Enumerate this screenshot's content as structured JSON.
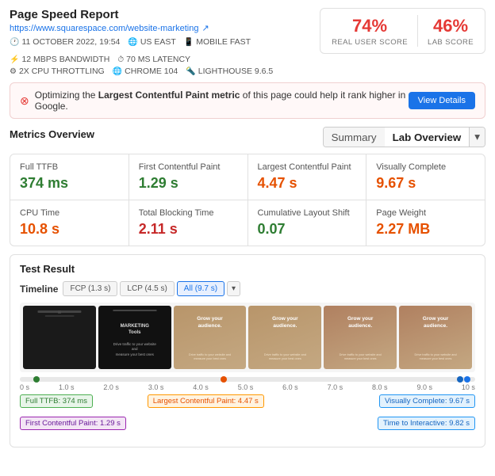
{
  "header": {
    "title": "Page Speed Report",
    "url": "https://www.squarespace.com/website-marketing",
    "meta": [
      {
        "icon": "🕐",
        "text": "11 OCTOBER 2022, 19:54"
      },
      {
        "icon": "🌐",
        "text": "US EAST"
      },
      {
        "icon": "📱",
        "text": "MOBILE FAST"
      },
      {
        "icon": "⚡",
        "text": "12 MBPS BANDWIDTH"
      },
      {
        "icon": "⏱",
        "text": "70 MS LATENCY"
      },
      {
        "icon": "⚙",
        "text": "2X CPU THROTTLING"
      },
      {
        "icon": "🌐",
        "text": "CHROME 104"
      },
      {
        "icon": "🔦",
        "text": "LIGHTHOUSE 9.6.5"
      }
    ],
    "scores": {
      "real_user": {
        "value": "74%",
        "label": "REAL USER SCORE"
      },
      "lab": {
        "value": "46%",
        "label": "LAB SCORE"
      }
    }
  },
  "alert": {
    "text_before": "Optimizing the ",
    "highlight": "Largest Contentful Paint metric",
    "text_after": " of this page could help it rank higher in Google.",
    "button": "View Details"
  },
  "metrics": {
    "section_title": "Metrics Overview",
    "tabs": [
      "Summary",
      "Lab Overview"
    ],
    "cards": [
      {
        "label": "Full TTFB",
        "value": "374 ms",
        "color": "green"
      },
      {
        "label": "First Contentful Paint",
        "value": "1.29 s",
        "color": "green"
      },
      {
        "label": "Largest Contentful Paint",
        "value": "4.47 s",
        "color": "orange"
      },
      {
        "label": "Visually Complete",
        "value": "9.67 s",
        "color": "orange"
      },
      {
        "label": "CPU Time",
        "value": "10.8 s",
        "color": "orange"
      },
      {
        "label": "Total Blocking Time",
        "value": "2.11 s",
        "color": "red"
      },
      {
        "label": "Cumulative Layout Shift",
        "value": "0.07",
        "color": "green"
      },
      {
        "label": "Page Weight",
        "value": "2.27 MB",
        "color": "orange"
      }
    ]
  },
  "test_result": {
    "title": "Test Result",
    "timeline": {
      "label": "Timeline",
      "filters": [
        "FCP (1.3 s)",
        "LCP (4.5 s)",
        "All (9.7 s)"
      ],
      "active_filter": "All (9.7 s)"
    },
    "ruler": {
      "labels": [
        "0 s",
        "1.0 s",
        "2.0 s",
        "3.0 s",
        "4.0 s",
        "5.0 s",
        "6.0 s",
        "7.0 s",
        "8.0 s",
        "9.0 s",
        "10 s"
      ]
    },
    "annotations": [
      {
        "type": "green",
        "label": "Full TTFB: 374 ms",
        "left_pct": 2
      },
      {
        "type": "orange",
        "label": "Largest Contentful Paint: 4.47 s",
        "left_pct": 35
      },
      {
        "type": "blue",
        "label": "Visually Complete: 9.67 s",
        "left_pct": 63
      },
      {
        "type": "purple",
        "label": "First Contentful Paint: 1.29 s",
        "left_pct": 2
      },
      {
        "type": "blue",
        "label": "Time to Interactive: 9.82 s",
        "left_pct": 63
      }
    ]
  }
}
